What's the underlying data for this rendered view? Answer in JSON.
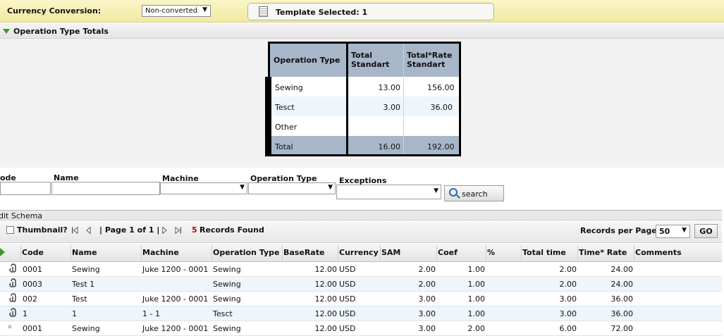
{
  "topbar": {
    "currency_label": "Currency Conversion:",
    "currency_value": "Non-converted",
    "template_text": "Template Selected: 1"
  },
  "section": {
    "title": "Operation Type Totals"
  },
  "totals": {
    "headers": [
      "Operation Type",
      "Total Standart",
      "Total*Rate Standart"
    ],
    "rows": [
      {
        "type": "Sewing",
        "total": "13.00",
        "rate": "156.00"
      },
      {
        "type": "Tesct",
        "total": "3.00",
        "rate": "36.00"
      },
      {
        "type": "Other",
        "total": "",
        "rate": ""
      }
    ],
    "footer": {
      "type": "Total",
      "total": "16.00",
      "rate": "192.00"
    }
  },
  "filters": {
    "code_label": "ode",
    "name_label": "Name",
    "machine_label": "Machine",
    "optype_label": "Operation Type",
    "exceptions_label": "Exceptions",
    "search_label": "search"
  },
  "grid": {
    "edit_schema": "dit Schema",
    "thumbnail_label": "Thumbnail?",
    "page_text": "| Page 1 of 1 |",
    "records_count": "5",
    "records_text": "Records Found",
    "rpp_label": "Records per Page:",
    "rpp_value": "50",
    "go_label": "GO",
    "columns": [
      "Code",
      "Name",
      "Machine",
      "Operation Type",
      "BaseRate",
      "Currency",
      "SAM",
      "Coef",
      "%",
      "Total time",
      "Time* Rate",
      "Comments"
    ],
    "rows": [
      {
        "code": "0001",
        "name": "Sewing",
        "machine": "Juke 1200 - 0001",
        "optype": "Sewing",
        "baserate": "12.00",
        "currency": "USD",
        "sam": "2.00",
        "coef": "1.00",
        "total_time": "2.00",
        "time_rate": "24.00"
      },
      {
        "code": "0003",
        "name": "Test 1",
        "machine": "",
        "optype": "Sewing",
        "baserate": "12.00",
        "currency": "USD",
        "sam": "2.00",
        "coef": "1.00",
        "total_time": "2.00",
        "time_rate": "24.00"
      },
      {
        "code": "002",
        "name": "Test",
        "machine": "Juke 1200 - 0001",
        "optype": "Sewing",
        "baserate": "12.00",
        "currency": "USD",
        "sam": "3.00",
        "coef": "1.00",
        "total_time": "3.00",
        "time_rate": "36.00"
      },
      {
        "code": "1",
        "name": "1",
        "machine": "1 - 1",
        "optype": "Tesct",
        "baserate": "12.00",
        "currency": "USD",
        "sam": "3.00",
        "coef": "1.00",
        "total_time": "3.00",
        "time_rate": "36.00"
      },
      {
        "code": "0001",
        "name": "Sewing",
        "machine": "Juke 1200 - 0001",
        "optype": "Sewing",
        "baserate": "12.00",
        "currency": "USD",
        "sam": "3.00",
        "coef": "2.00",
        "total_time": "6.00",
        "time_rate": "72.00"
      }
    ]
  },
  "colors": {
    "topbar": "#f1e9a2",
    "totals_header": "#a7b7c9",
    "records_count": "#c00000",
    "accent_green": "#3b9b1f"
  }
}
